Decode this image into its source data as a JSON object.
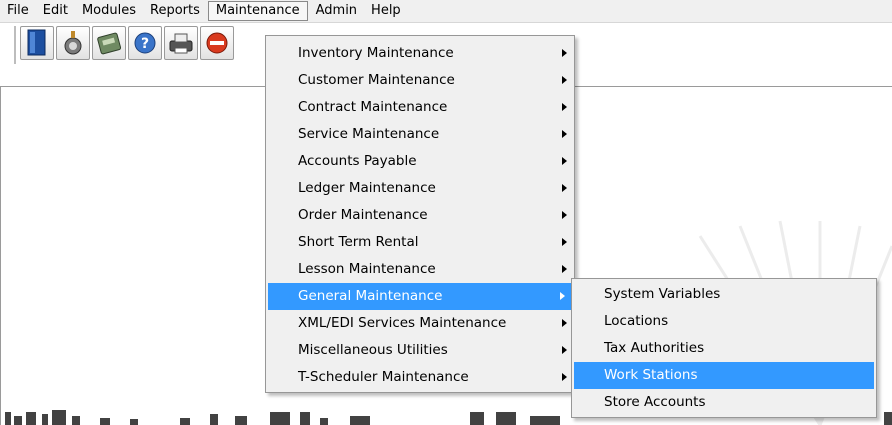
{
  "menubar": {
    "items": [
      "File",
      "Edit",
      "Modules",
      "Reports",
      "Maintenance",
      "Admin",
      "Help"
    ],
    "active": "Maintenance"
  },
  "toolbar": {
    "icons": [
      "document-icon",
      "wizard-icon",
      "register-icon",
      "help-icon",
      "printer-icon",
      "stop-icon"
    ]
  },
  "maintenance_menu": {
    "items": [
      {
        "label": "Inventory Maintenance",
        "submenu": true
      },
      {
        "label": "Customer Maintenance",
        "submenu": true
      },
      {
        "label": "Contract Maintenance",
        "submenu": true
      },
      {
        "label": "Service Maintenance",
        "submenu": true
      },
      {
        "label": "Accounts Payable",
        "submenu": true
      },
      {
        "label": "Ledger Maintenance",
        "submenu": true
      },
      {
        "label": "Order Maintenance",
        "submenu": true
      },
      {
        "label": "Short Term Rental",
        "submenu": true
      },
      {
        "label": "Lesson Maintenance",
        "submenu": true
      },
      {
        "label": "General Maintenance",
        "submenu": true,
        "highlighted": true
      },
      {
        "label": "XML/EDI Services Maintenance",
        "submenu": true
      },
      {
        "label": "Miscellaneous Utilities",
        "submenu": true
      },
      {
        "label": "T-Scheduler Maintenance",
        "submenu": true
      }
    ]
  },
  "general_submenu": {
    "items": [
      {
        "label": "System Variables"
      },
      {
        "label": "Locations"
      },
      {
        "label": "Tax Authorities"
      },
      {
        "label": "Work Stations",
        "highlighted": true
      },
      {
        "label": "Store Accounts"
      }
    ]
  },
  "colors": {
    "highlight": "#3399ff",
    "menu_bg": "#f0f0f0",
    "menubar_bg": "#f0f0f0"
  }
}
